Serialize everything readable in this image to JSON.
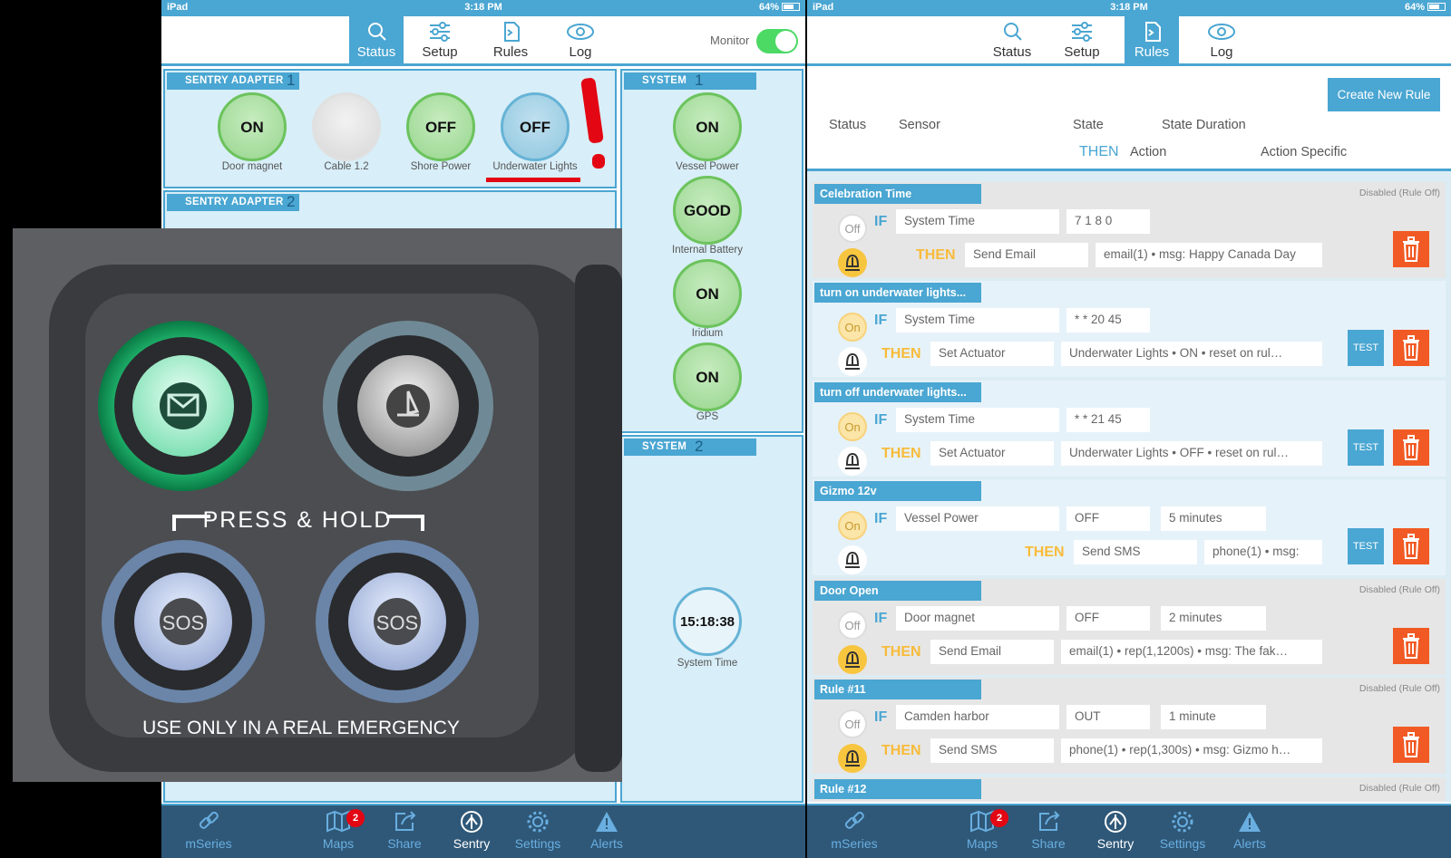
{
  "left": {
    "status_bar": {
      "device": "iPad",
      "time": "3:18 PM",
      "battery": "64%"
    },
    "tabs": [
      {
        "label": "Status",
        "icon": "search-icon"
      },
      {
        "label": "Setup",
        "icon": "sliders-icon"
      },
      {
        "label": "Rules",
        "icon": "rules-doc-icon"
      },
      {
        "label": "Log",
        "icon": "eye-icon"
      }
    ],
    "active_tab": "Status",
    "monitor": {
      "label": "Monitor",
      "on": true
    },
    "sentry_adapter_1": {
      "title": "SENTRY ADAPTER",
      "number": "1",
      "gauges": [
        {
          "value": "ON",
          "label": "Door magnet",
          "color": "#97d58d"
        },
        {
          "value": "",
          "label": "Cable 1.2",
          "color": "#d7d7d7"
        },
        {
          "value": "OFF",
          "label": "Shore Power",
          "color": "#97d58d"
        },
        {
          "value": "OFF",
          "label": "Underwater Lights",
          "color": "#8fc6df"
        }
      ]
    },
    "sentry_adapter_2": {
      "title": "SENTRY ADAPTER",
      "number": "2"
    },
    "system_1": {
      "title": "SYSTEM",
      "number": "1",
      "gauges": [
        {
          "value": "ON",
          "label": "Vessel Power"
        },
        {
          "value": "GOOD",
          "label": "Internal Battery"
        },
        {
          "value": "ON",
          "label": "Iridium"
        },
        {
          "value": "ON",
          "label": "GPS"
        }
      ]
    },
    "system_2": {
      "title": "SYSTEM",
      "number": "2",
      "clock": {
        "value": "15:18:38",
        "label": "System Time"
      }
    },
    "photo": {
      "press_hold": "PRESS & HOLD",
      "warning": "USE ONLY IN A REAL EMERGENCY",
      "sos_1": "SOS",
      "sos_2": "SOS"
    },
    "bottom_nav": [
      {
        "label": "mSeries",
        "icon": "link-icon"
      },
      {
        "label": "Maps",
        "icon": "map-icon",
        "badge": "2"
      },
      {
        "label": "Share",
        "icon": "share-icon"
      },
      {
        "label": "Sentry",
        "icon": "sentry-icon"
      },
      {
        "label": "Settings",
        "icon": "gear-icon"
      },
      {
        "label": "Alerts",
        "icon": "warning-icon"
      }
    ]
  },
  "right": {
    "status_bar": {
      "device": "iPad",
      "time": "3:18 PM",
      "battery": "64%"
    },
    "tabs": [
      {
        "label": "Status",
        "icon": "search-icon"
      },
      {
        "label": "Setup",
        "icon": "sliders-icon"
      },
      {
        "label": "Rules",
        "icon": "rules-doc-icon"
      },
      {
        "label": "Log",
        "icon": "eye-icon"
      }
    ],
    "active_tab": "Rules",
    "create_rule_label": "Create New Rule",
    "columns": {
      "status": "Status",
      "sensor": "Sensor",
      "state": "State",
      "state_duration": "State Duration",
      "then": "THEN",
      "action": "Action",
      "action_specific": "Action Specific"
    },
    "keywords": {
      "if": "IF",
      "then": "THEN",
      "test": "TEST"
    },
    "rules": [
      {
        "name": "Celebration Time",
        "status": "Off",
        "disabled_note": "Disabled (Rule Off)",
        "sensor": "System Time",
        "state": "7 1 8 0",
        "duration": "",
        "action": "Send Email",
        "action_specific": "email(1) • msg: Happy Canada Day"
      },
      {
        "name": "turn on underwater lights...",
        "status": "On",
        "disabled_note": "",
        "sensor": "System Time",
        "state": "* * 20 45",
        "duration": "",
        "action": "Set Actuator",
        "action_specific": "Underwater Lights • ON • reset on rul…"
      },
      {
        "name": "turn off underwater lights...",
        "status": "On",
        "disabled_note": "",
        "sensor": "System Time",
        "state": "* * 21 45",
        "duration": "",
        "action": "Set Actuator",
        "action_specific": "Underwater Lights • OFF • reset on rul…"
      },
      {
        "name": "Gizmo 12v",
        "status": "On",
        "disabled_note": "",
        "sensor": "Vessel Power",
        "state": "OFF",
        "duration": "5 minutes",
        "action": "Send SMS",
        "action_specific": "phone(1) • msg:"
      },
      {
        "name": "Door Open",
        "status": "Off",
        "disabled_note": "Disabled (Rule Off)",
        "sensor": "Door magnet",
        "state": "OFF",
        "duration": "2 minutes",
        "action": "Send Email",
        "action_specific": "email(1) • rep(1,1200s) • msg: The fak…"
      },
      {
        "name": "Rule #11",
        "status": "Off",
        "disabled_note": "Disabled (Rule Off)",
        "sensor": "Camden harbor",
        "state": "OUT",
        "duration": "1 minute",
        "action": "Send SMS",
        "action_specific": "phone(1) • rep(1,300s) • msg: Gizmo h…"
      },
      {
        "name": "Rule #12",
        "status": "",
        "disabled_note": "Disabled (Rule Off)",
        "sensor": "",
        "state": "",
        "duration": "",
        "action": "",
        "action_specific": ""
      }
    ],
    "bottom_nav": [
      {
        "label": "mSeries",
        "icon": "link-icon"
      },
      {
        "label": "Maps",
        "icon": "map-icon",
        "badge": "2"
      },
      {
        "label": "Share",
        "icon": "share-icon"
      },
      {
        "label": "Sentry",
        "icon": "sentry-icon"
      },
      {
        "label": "Settings",
        "icon": "gear-icon"
      },
      {
        "label": "Alerts",
        "icon": "warning-icon"
      }
    ]
  }
}
